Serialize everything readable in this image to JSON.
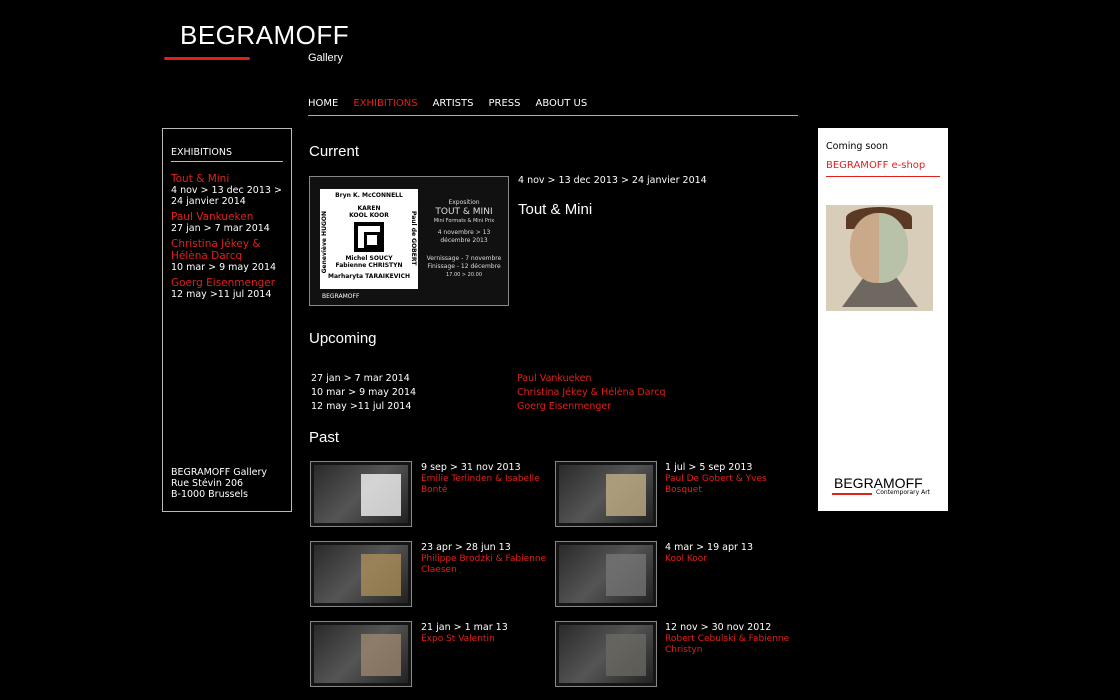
{
  "logo": {
    "title": "BEGRAMOFF",
    "subtitle": "Gallery"
  },
  "nav": [
    "HOME",
    "EXHIBITIONS",
    "ARTISTS",
    "PRESS",
    "ABOUT US"
  ],
  "sidebar": {
    "heading": "EXHIBITIONS",
    "items": [
      {
        "title": "Tout & Mini",
        "dates": "4 nov > 13 dec 2013 > 24 janvier 2014"
      },
      {
        "title": "Paul Vankueken",
        "dates": "27 jan > 7 mar 2014"
      },
      {
        "title": "Christina Jékey & Hélèna Darcq",
        "dates": "10 mar > 9 may 2014"
      },
      {
        "title": "Goerg Eisenmenger",
        "dates": "12 may >11 jul 2014"
      }
    ],
    "address": [
      "BEGRAMOFF Gallery",
      "Rue Stévin 206",
      "B-1000 Brussels"
    ]
  },
  "current": {
    "heading": "Current",
    "dates": "4 nov > 13 dec 2013 > 24 janvier 2014",
    "title": "Tout & Mini",
    "poster": {
      "top": "Bryn K. McCONNELL",
      "names": "KAREN",
      "koolkoor": "KOOL KOOR",
      "michel": "Michel SOUCY",
      "fabienne": "Fabienne CHRISTYN",
      "bottom": "Marharyta TARAIKEVICH",
      "left": "Geneviève HUGON",
      "right": "Paul de GOBERT",
      "exposition": "Exposition",
      "show": "TOUT & MINI",
      "formats": "Mini Formats & Mini Prix",
      "period": "4 novembre > 13 décembre 2013",
      "vernissage": "Vernissage - 7 novembre",
      "finissage": "Finissage - 12 décembre",
      "hours": "17.00 > 20.00",
      "brand": "BEGRAMOFF"
    }
  },
  "upcoming": {
    "heading": "Upcoming",
    "rows": [
      {
        "dates": "27 jan > 7 mar 2014",
        "name": "Paul Vankueken"
      },
      {
        "dates": "10 mar > 9 may 2014",
        "name": "Christina Jékey & Hélèna Darcq"
      },
      {
        "dates": "12 may >11 jul 2014",
        "name": "Goerg Eisenmenger"
      }
    ]
  },
  "past": {
    "heading": "Past",
    "items": [
      {
        "dates": "9 sep > 31 nov 2013",
        "name": "Emilie Terlinden & Isabelle Bonté"
      },
      {
        "dates": "1 jul > 5 sep 2013",
        "name": "Paul De Gobert & Yves Bosquet"
      },
      {
        "dates": "23 apr > 28 jun 13",
        "name": "Philippe Brodzki & Fabienne Claesen"
      },
      {
        "dates": "4 mar > 19 apr 13",
        "name": "Kool Koor"
      },
      {
        "dates": "21 jan > 1 mar 13",
        "name": "Expo St Valentin"
      },
      {
        "dates": "12 nov > 30 nov 2012",
        "name": "Robert Cebulski & Fabienne Christyn"
      }
    ]
  },
  "right_panel": {
    "coming": "Coming soon",
    "shop": "BEGRAMOFF e-shop",
    "logo": "BEGRAMOFF",
    "logo_sub": "Contemporary Art"
  }
}
